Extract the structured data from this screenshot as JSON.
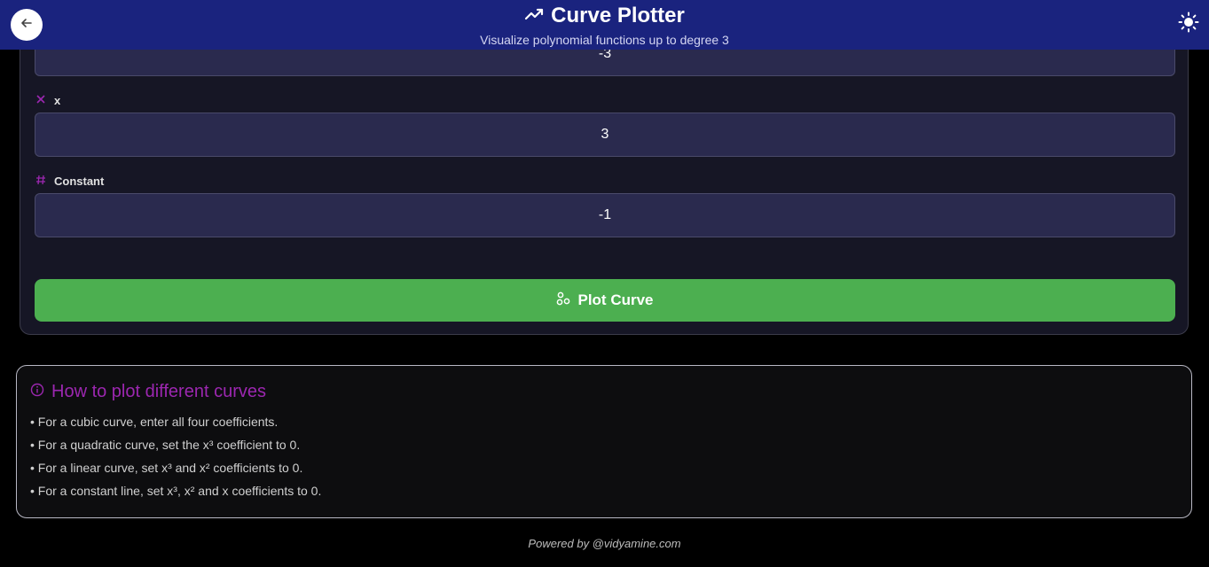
{
  "header": {
    "title": "Curve Plotter",
    "subtitle": "Visualize polynomial functions up to degree 3",
    "back_icon": "arrow-left-icon",
    "trend_icon": "trending-up-icon",
    "theme_icon": "sun-icon"
  },
  "form": {
    "top_value": "-3",
    "fields": [
      {
        "label": "x",
        "icon": "x-icon",
        "value": "3"
      },
      {
        "label": "Constant",
        "icon": "hash-icon",
        "value": "-1"
      }
    ],
    "plot_button": {
      "label": "Plot Curve",
      "icon": "scatter-icon"
    }
  },
  "help": {
    "title": "How to plot different curves",
    "icon": "info-icon",
    "items": [
      "• For a cubic curve, enter all four coefficients.",
      "• For a quadratic curve, set the x³ coefficient to 0.",
      "• For a linear curve, set x³ and x² coefficients to 0.",
      "• For a constant line, set x³, x² and x coefficients to 0."
    ]
  },
  "footer": "Powered by @vidyamine.com",
  "colors": {
    "appbar": "#1a237e",
    "accent": "#9c27b0",
    "button": "#4caf50",
    "card": "#161625",
    "input": "#2a2a4e"
  }
}
